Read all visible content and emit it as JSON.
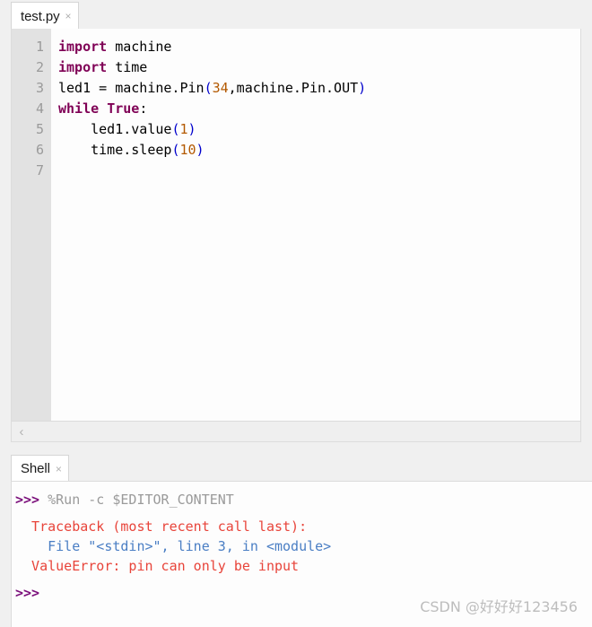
{
  "editor": {
    "tab": {
      "label": "test.py",
      "close_icon": "×"
    },
    "gutter_numbers": [
      "1",
      "2",
      "3",
      "4",
      "5",
      "6",
      "7"
    ],
    "lines": [
      {
        "number": "1",
        "text": "import machine",
        "tokens": [
          {
            "t": "import",
            "k": "kw"
          },
          {
            "t": " machine",
            "k": "plain"
          }
        ]
      },
      {
        "number": "2",
        "text": "import time",
        "tokens": [
          {
            "t": "import",
            "k": "kw"
          },
          {
            "t": " time",
            "k": "plain"
          }
        ]
      },
      {
        "number": "3",
        "text": "led1 = machine.Pin(34,machine.Pin.OUT)",
        "tokens": [
          {
            "t": "led1 = machine.Pin",
            "k": "plain"
          },
          {
            "t": "(",
            "k": "paren"
          },
          {
            "t": "34",
            "k": "num"
          },
          {
            "t": ",machine.Pin.OUT",
            "k": "plain"
          },
          {
            "t": ")",
            "k": "paren"
          }
        ]
      },
      {
        "number": "4",
        "text": "while True:",
        "tokens": [
          {
            "t": "while",
            "k": "kw"
          },
          {
            "t": " ",
            "k": "plain"
          },
          {
            "t": "True",
            "k": "kw"
          },
          {
            "t": ":",
            "k": "plain"
          }
        ]
      },
      {
        "number": "5",
        "text": "    led1.value(1)",
        "tokens": [
          {
            "t": "    led1.value",
            "k": "plain"
          },
          {
            "t": "(",
            "k": "paren"
          },
          {
            "t": "1",
            "k": "num"
          },
          {
            "t": ")",
            "k": "paren"
          }
        ]
      },
      {
        "number": "6",
        "text": "    time.sleep(10)",
        "tokens": [
          {
            "t": "    time.sleep",
            "k": "plain"
          },
          {
            "t": "(",
            "k": "paren"
          },
          {
            "t": "10",
            "k": "num"
          },
          {
            "t": ")",
            "k": "paren"
          }
        ]
      },
      {
        "number": "7",
        "text": "",
        "tokens": []
      }
    ],
    "hscrollbar": {
      "left_arrow_icon": "‹"
    }
  },
  "shell": {
    "tab": {
      "label": "Shell",
      "close_icon": "×"
    },
    "lines": [
      {
        "segments": [
          {
            "t": ">>> ",
            "k": "prompt"
          },
          {
            "t": "%Run -c $EDITOR_CONTENT",
            "k": "cmd"
          }
        ]
      },
      {
        "gap": true
      },
      {
        "segments": [
          {
            "t": "  Traceback (most recent call last):",
            "k": "error"
          }
        ]
      },
      {
        "segments": [
          {
            "t": "    File \"<stdin>\", line 3, in <module>",
            "k": "link"
          }
        ]
      },
      {
        "segments": [
          {
            "t": "  ValueError: pin can only be input",
            "k": "error"
          }
        ]
      },
      {
        "gap": true
      },
      {
        "segments": [
          {
            "t": ">>>",
            "k": "prompt"
          }
        ]
      }
    ]
  },
  "watermark": {
    "text": "CSDN @好好好123456"
  },
  "colors": {
    "keyword": "#7f0055",
    "number": "#b35900",
    "paren": "#0000cc",
    "prompt": "#7b0f7b",
    "command": "#9a9a9a",
    "error": "#e8443a",
    "link": "#4a7ec4",
    "gutter_bg": "#e2e2e2",
    "editor_bg": "#fdfdfd",
    "window_bg": "#f0f0f0"
  }
}
